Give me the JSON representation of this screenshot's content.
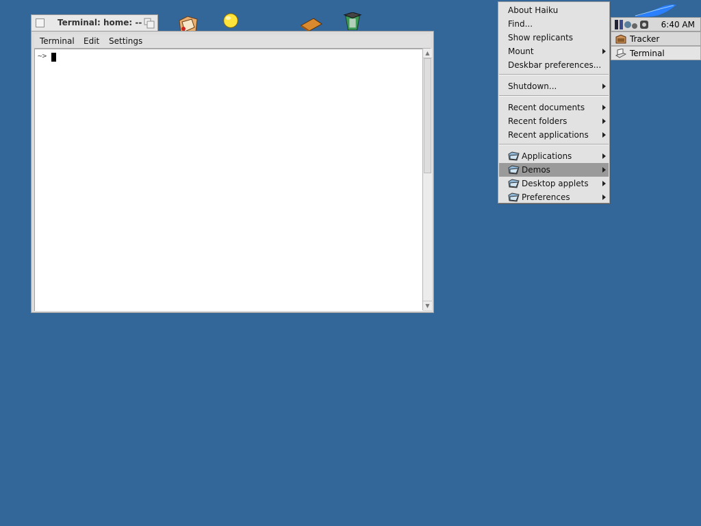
{
  "terminal": {
    "title": "Terminal: home: --",
    "menus": [
      "Terminal",
      "Edit",
      "Settings"
    ],
    "prompt": "~>"
  },
  "deskbar": {
    "clock": "6:40 AM",
    "apps": [
      {
        "label": "Tracker",
        "icon": "tracker-icon"
      },
      {
        "label": "Terminal",
        "icon": "terminal-icon"
      }
    ],
    "menu": {
      "groups": [
        [
          {
            "label": "About Haiku",
            "submenu": false
          },
          {
            "label": "Find...",
            "submenu": false
          },
          {
            "label": "Show replicants",
            "submenu": false
          },
          {
            "label": "Mount",
            "submenu": true
          },
          {
            "label": "Deskbar preferences...",
            "submenu": false
          }
        ],
        [
          {
            "label": "Shutdown...",
            "submenu": true
          }
        ],
        [
          {
            "label": "Recent documents",
            "submenu": true
          },
          {
            "label": "Recent folders",
            "submenu": true
          },
          {
            "label": "Recent applications",
            "submenu": true
          }
        ],
        [
          {
            "label": "Applications",
            "submenu": true,
            "folder_icon": true
          },
          {
            "label": "Demos",
            "submenu": true,
            "folder_icon": true,
            "highlighted": true
          },
          {
            "label": "Desktop applets",
            "submenu": true,
            "folder_icon": true
          },
          {
            "label": "Preferences",
            "submenu": true,
            "folder_icon": true
          }
        ]
      ]
    }
  },
  "colors": {
    "desktop": "#336699",
    "menu_bg": "#e2e2e2",
    "highlight": "#9a9a9a"
  }
}
